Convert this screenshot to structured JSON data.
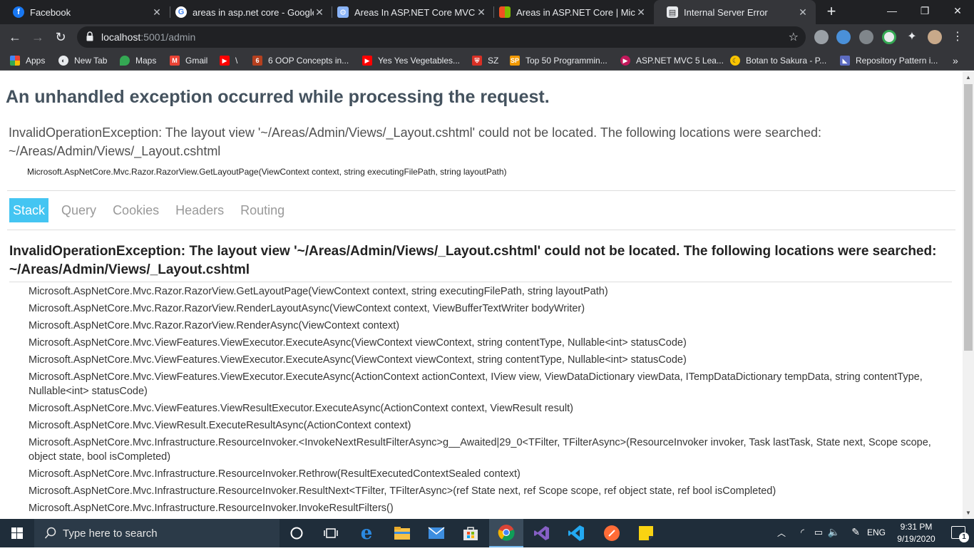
{
  "browser": {
    "tabs": [
      {
        "title": "Facebook",
        "icon": "facebook-icon",
        "color": "#1877f2"
      },
      {
        "title": "areas in asp.net core - Google",
        "icon": "google-icon",
        "color": "#ffffff"
      },
      {
        "title": "Areas In ASP.NET Core MVC",
        "icon": "robot-icon",
        "color": "#8ab4f8"
      },
      {
        "title": "Areas in ASP.NET Core | Micros",
        "icon": "microsoft-icon",
        "color": "#f25022"
      },
      {
        "title": "Internal Server Error",
        "icon": "page-icon",
        "color": "#e8eaed"
      }
    ],
    "url_host": "localhost",
    "url_rest": ":5001/admin",
    "bookmarks": [
      {
        "label": "Apps",
        "icon": "apps-grid-icon"
      },
      {
        "label": "New Tab",
        "icon": "globe-icon"
      },
      {
        "label": "Maps",
        "icon": "maps-pin-icon"
      },
      {
        "label": "Gmail",
        "icon": "gmail-icon"
      },
      {
        "label": "\\",
        "icon": "youtube-icon"
      },
      {
        "label": "6 OOP Concepts in...",
        "icon": "bookmark-icon"
      },
      {
        "label": "Yes Yes Vegetables...",
        "icon": "youtube-icon"
      },
      {
        "label": "SZ",
        "icon": "shield-icon"
      },
      {
        "label": "Top 50 Programmin...",
        "icon": "sp-icon"
      },
      {
        "label": "ASP.NET MVC 5 Lea...",
        "icon": "play-icon"
      },
      {
        "label": "Botan to Sakura - P...",
        "icon": "moon-icon"
      },
      {
        "label": "Repository Pattern i...",
        "icon": "visual-studio-icon"
      }
    ]
  },
  "page": {
    "title": "An unhandled exception occurred while processing the request.",
    "message": "InvalidOperationException: The layout view '~/Areas/Admin/Views/_Layout.cshtml' could not be located. The following locations were searched: ~/Areas/Admin/Views/_Layout.cshtml",
    "location": "Microsoft.AspNetCore.Mvc.Razor.RazorView.GetLayoutPage(ViewContext context, string executingFilePath, string layoutPath)",
    "tabs": [
      "Stack",
      "Query",
      "Cookies",
      "Headers",
      "Routing"
    ],
    "active_tab": "Stack",
    "stack_heading": "InvalidOperationException: The layout view '~/Areas/Admin/Views/_Layout.cshtml' could not be located. The following locations were searched: ~/Areas/Admin/Views/_Layout.cshtml",
    "frames": [
      "Microsoft.AspNetCore.Mvc.Razor.RazorView.GetLayoutPage(ViewContext context, string executingFilePath, string layoutPath)",
      "Microsoft.AspNetCore.Mvc.Razor.RazorView.RenderLayoutAsync(ViewContext context, ViewBufferTextWriter bodyWriter)",
      "Microsoft.AspNetCore.Mvc.Razor.RazorView.RenderAsync(ViewContext context)",
      "Microsoft.AspNetCore.Mvc.ViewFeatures.ViewExecutor.ExecuteAsync(ViewContext viewContext, string contentType, Nullable<int> statusCode)",
      "Microsoft.AspNetCore.Mvc.ViewFeatures.ViewExecutor.ExecuteAsync(ViewContext viewContext, string contentType, Nullable<int> statusCode)",
      "Microsoft.AspNetCore.Mvc.ViewFeatures.ViewExecutor.ExecuteAsync(ActionContext actionContext, IView view, ViewDataDictionary viewData, ITempDataDictionary tempData, string contentType, Nullable<int> statusCode)",
      "Microsoft.AspNetCore.Mvc.ViewFeatures.ViewResultExecutor.ExecuteAsync(ActionContext context, ViewResult result)",
      "Microsoft.AspNetCore.Mvc.ViewResult.ExecuteResultAsync(ActionContext context)",
      "Microsoft.AspNetCore.Mvc.Infrastructure.ResourceInvoker.<InvokeNextResultFilterAsync>g__Awaited|29_0<TFilter, TFilterAsync>(ResourceInvoker invoker, Task lastTask, State next, Scope scope, object state, bool isCompleted)",
      "Microsoft.AspNetCore.Mvc.Infrastructure.ResourceInvoker.Rethrow(ResultExecutedContextSealed context)",
      "Microsoft.AspNetCore.Mvc.Infrastructure.ResourceInvoker.ResultNext<TFilter, TFilterAsync>(ref State next, ref Scope scope, ref object state, ref bool isCompleted)",
      "Microsoft.AspNetCore.Mvc.Infrastructure.ResourceInvoker.InvokeResultFilters()"
    ]
  },
  "taskbar": {
    "search_placeholder": "Type here to search",
    "language": "ENG",
    "time": "9:31 PM",
    "date": "9/19/2020",
    "notifications": "1",
    "apps": [
      "task-view-icon",
      "edge-icon",
      "file-explorer-icon",
      "mail-icon",
      "store-icon",
      "chrome-icon",
      "visual-studio-icon",
      "vscode-icon",
      "postman-icon",
      "sticky-notes-icon"
    ]
  },
  "colors": {
    "accent_tab": "#44c5f2",
    "title_text": "#44525e"
  }
}
